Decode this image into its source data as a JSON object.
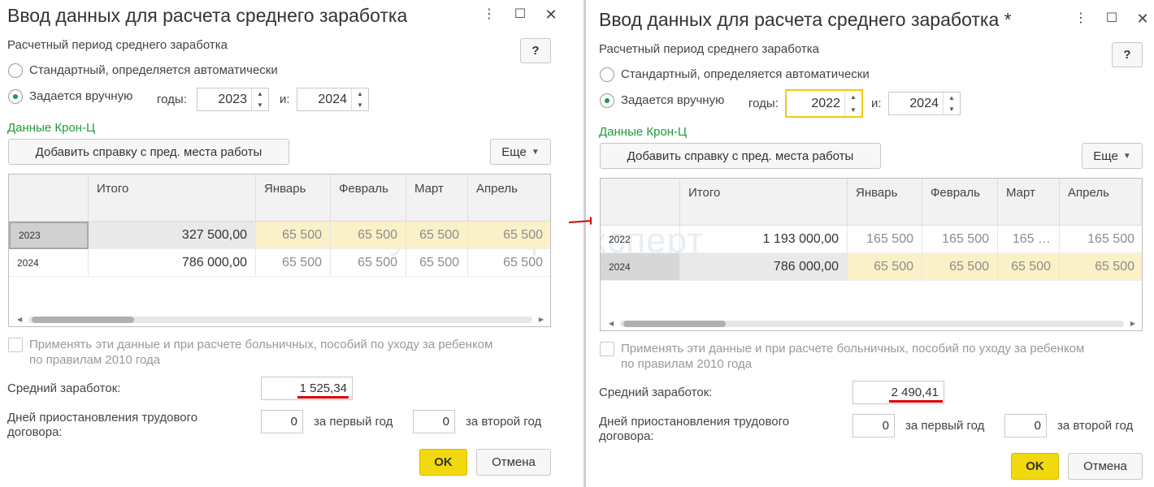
{
  "watermark": "БухЭксперт",
  "left": {
    "title": "Ввод данных для расчета среднего заработка",
    "period_label": "Расчетный период среднего заработка",
    "help": "?",
    "opt_standard": "Стандартный, определяется автоматически",
    "opt_manual": "Задается вручную",
    "years_label": "годы:",
    "and_label": "и:",
    "year_from": "2023",
    "year_to": "2024",
    "kron_link": "Данные Крон-Ц",
    "add_btn": "Добавить справку с пред. места работы",
    "more_btn": "Еще",
    "columns": [
      "",
      "Итого",
      "Январь",
      "Февраль",
      "Март",
      "Апрель"
    ],
    "rows": [
      {
        "year": "2023",
        "total": "327 500,00",
        "m1": "65 500",
        "m2": "65 500",
        "m3": "65 500",
        "m4": "65 500"
      },
      {
        "year": "2024",
        "total": "786 000,00",
        "m1": "65 500",
        "m2": "65 500",
        "m3": "65 500",
        "m4": "65 500"
      }
    ],
    "apply_text_1": "Применять эти данные и при расчете больничных, пособий по уходу за ребенком",
    "apply_text_2": "по правилам 2010 года",
    "avg_label": "Средний заработок:",
    "avg_value": "1 525,34",
    "days_label_1": "Дней приостановления трудового",
    "days_label_2": "договора:",
    "days_first": "0",
    "first_year_label": "за первый год",
    "days_second": "0",
    "second_year_label": "за второй год",
    "ok": "OK",
    "cancel": "Отмена"
  },
  "right": {
    "title": "Ввод данных для расчета среднего заработка *",
    "period_label": "Расчетный период среднего заработка",
    "help": "?",
    "opt_standard": "Стандартный, определяется автоматически",
    "opt_manual": "Задается вручную",
    "years_label": "годы:",
    "and_label": "и:",
    "year_from": "2022",
    "year_to": "2024",
    "kron_link": "Данные Крон-Ц",
    "add_btn": "Добавить справку с пред. места работы",
    "more_btn": "Еще",
    "columns": [
      "",
      "Итого",
      "Январь",
      "Февраль",
      "Март",
      "Апрель"
    ],
    "rows": [
      {
        "year": "2022",
        "total": "1 193 000,00",
        "m1": "165 500",
        "m2": "165 500",
        "m3": "165 …",
        "m4": "165 500"
      },
      {
        "year": "2024",
        "total": "786 000,00",
        "m1": "65 500",
        "m2": "65 500",
        "m3": "65 500",
        "m4": "65 500"
      }
    ],
    "apply_text_1": "Применять эти данные и при расчете больничных, пособий по уходу за ребенком",
    "apply_text_2": "по правилам 2010 года",
    "avg_label": "Средний заработок:",
    "avg_value": "2 490,41",
    "days_label_1": "Дней приостановления трудового",
    "days_label_2": "договора:",
    "days_first": "0",
    "first_year_label": "за первый год",
    "days_second": "0",
    "second_year_label": "за второй год",
    "ok": "OK",
    "cancel": "Отмена"
  },
  "colors": {
    "accent_green": "#1f9a3e",
    "ok_yellow": "#f2d80e",
    "highlight_row": "#fbf1c8",
    "annotation_red": "#d80000"
  },
  "icons": [
    "more-vertical-icon",
    "maximize-icon",
    "close-icon",
    "spin-up-icon",
    "spin-down-icon",
    "dropdown-caret-icon",
    "arrow-right-icon"
  ]
}
